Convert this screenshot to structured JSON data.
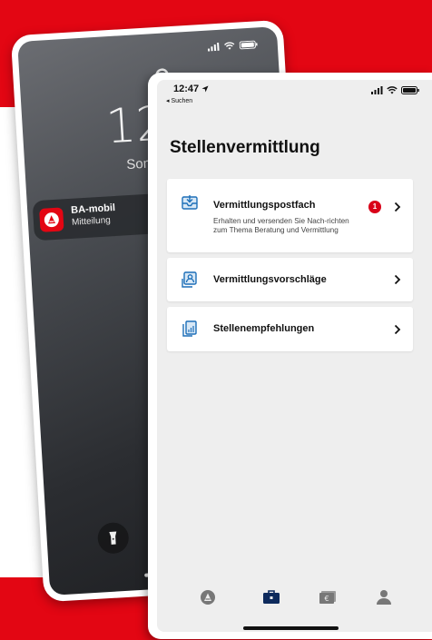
{
  "lockscreen": {
    "time": "12",
    "date": "Sonnta",
    "notification": {
      "app": "BA-mobil",
      "text": "Mitteilung"
    },
    "icons": [
      "lock-icon",
      "flashlight-icon",
      "signal-icon",
      "wifi-icon",
      "battery-icon"
    ]
  },
  "status": {
    "time": "12:47",
    "back_label": "◂ Suchen"
  },
  "page": {
    "title": "Stellenvermittlung"
  },
  "cards": [
    {
      "title": "Vermittlungspostfach",
      "description": "Erhalten und versenden Sie Nach-richten zum Thema Beratung und Vermittlung",
      "badge": "1",
      "icon": "inbox-download-icon"
    },
    {
      "title": "Vermittlungsvorschläge",
      "icon": "person-card-icon"
    },
    {
      "title": "Stellenempfehlungen",
      "icon": "document-stack-icon"
    }
  ],
  "tabbar": {
    "items": [
      "agentur-logo-icon",
      "briefcase-icon",
      "money-icon",
      "profile-icon"
    ],
    "active_index": 1
  },
  "colors": {
    "brand_red": "#e30613",
    "accent_blue": "#1d6fb8",
    "badge_red": "#d90018",
    "app_background": "#eeeeee"
  }
}
